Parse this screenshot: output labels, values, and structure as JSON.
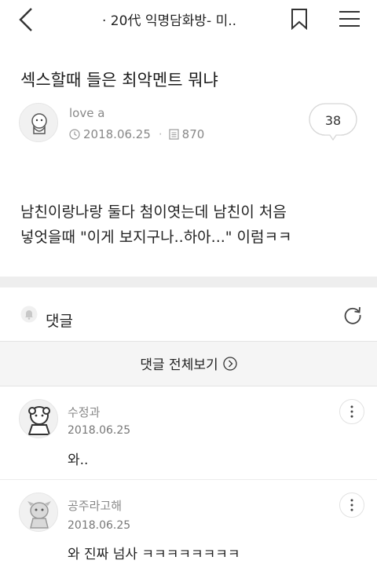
{
  "topbar": {
    "title": "· 20代 익명담화방- 미.."
  },
  "post": {
    "title": "섹스할때 들은 최악멘트 뭐냐",
    "author": "love a",
    "date": "2018.06.25",
    "views": "870",
    "comment_count": "38",
    "content_line1": "남친이랑나랑 둘다 첨이엿는데 남친이 처음",
    "content_line2": "넣엇을때 \"이게 보지구나..하아...\" 이럼ㅋㅋ"
  },
  "comments_section": {
    "label": "댓글",
    "view_all": "댓글 전체보기"
  },
  "comments": [
    {
      "author": "수정과",
      "date": "2018.06.25",
      "text": "와.."
    },
    {
      "author": "공주라고해",
      "date": "2018.06.25",
      "text": "와 진짜 넘사 ㅋㅋㅋㅋㅋㅋㅋㅋ"
    }
  ]
}
